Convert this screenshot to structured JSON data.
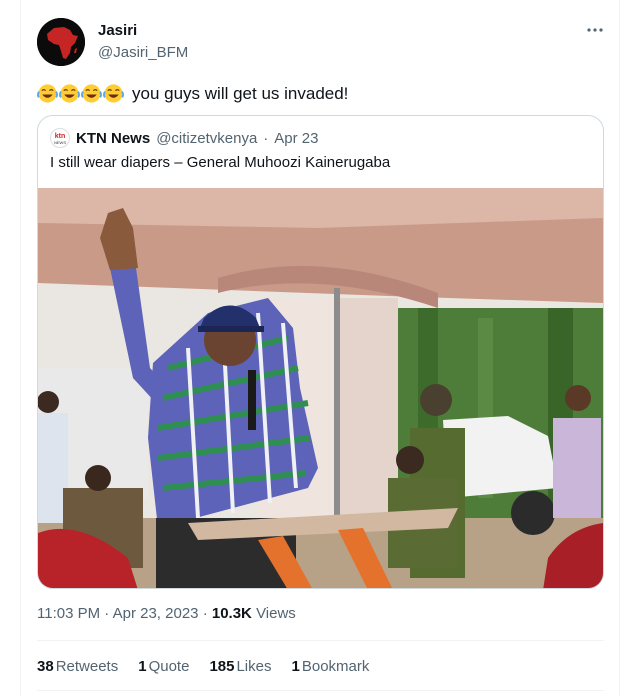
{
  "author": {
    "name": "Jasiri",
    "handle": "@Jasiri_BFM"
  },
  "more_icon": "more-horizontal-icon",
  "tweet": {
    "emoji_count": 4,
    "emoji_name": "face-with-tears-of-joy",
    "text": "you guys will get us invaded!"
  },
  "quoted": {
    "name": "KTN News",
    "handle": "@citizetvkenya",
    "sep": "·",
    "date": "Apr 23",
    "text": "I still wear diapers – General Muhoozi Kainerugaba",
    "logo_text_top": "ktn",
    "logo_text_bottom": "NEWS"
  },
  "meta": {
    "time": "11:03 PM",
    "sep1": "·",
    "date": "Apr 23, 2023",
    "sep2": "·",
    "views_count": "10.3K",
    "views_label": "Views"
  },
  "stats": [
    {
      "count": "38",
      "label": "Retweets"
    },
    {
      "count": "1",
      "label": "Quote"
    },
    {
      "count": "185",
      "label": "Likes"
    },
    {
      "count": "1",
      "label": "Bookmark"
    }
  ],
  "colors": {
    "text": "#0f1419",
    "secondary": "#536471",
    "border": "#cfd9de",
    "emoji": "#ffcc33"
  }
}
